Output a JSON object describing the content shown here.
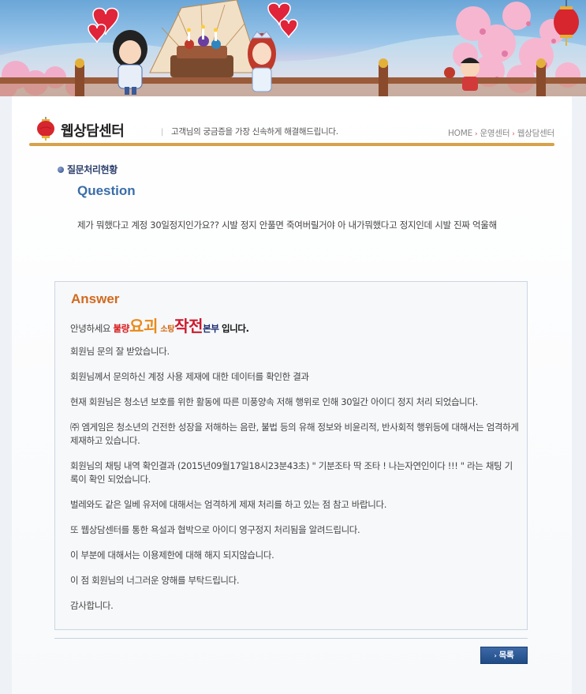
{
  "header": {
    "title": "웹상담센터",
    "subtitle": "고객님의 궁금증을 가장 신속하게 해결해드립니다.",
    "breadcrumb": [
      "HOME",
      "운영센터",
      "웹상담센터"
    ]
  },
  "question": {
    "status_label": "질문처리현황",
    "heading": "Question",
    "body": "제가 뭐했다고 계정 30일정지인가요?? 시발 정지 안풀면 죽여버릴거야 아 내가뭐했다고 정지인데 시발 진짜 억울해"
  },
  "answer": {
    "heading": "Answer",
    "greeting": {
      "prefix": "안녕하세요",
      "w1": "불량",
      "w2": "요괴",
      "w3": "소탕",
      "w4": "작전",
      "w5": "본부",
      "suffix": "입니다."
    },
    "paragraphs": [
      "회원님 문의 잘 받았습니다.",
      "회원님께서 문의하신 계정 사용 제재에 대한 데이터를 확인한 결과",
      "현재 회원님은 청소년 보호를 위한 활동에 따른 미풍양속 저해 행위로 인해 30일간 아이디 정지 처리 되었습니다.",
      "㈜ 엠게임은 청소년의 건전한 성장을 저해하는 음란, 불법 등의 유해 정보와 비윤리적, 반사회적 행위등에 대해서는 엄격하게 제재하고 있습니다.",
      "회원님의 채팅 내역 확인결과 (2015년09월17일18시23분43초) \" 기분조타 딱 조타 ! 나는자연인이다 !!! \" 라는 채팅 기록이 확인 되었습니다.",
      "벌레와도 같은 일베 유저에 대해서는 엄격하게 제재 처리를 하고 있는 점 참고 바랍니다.",
      "또 웹상담센터를 통한 욕설과 협박으로 아이디 영구정지 처리됨을 알려드립니다.",
      "이 부분에 대해서는 이용제한에 대해 해지 되지않습니다.",
      "이 점 회원님의 너그러운 양해를 부탁드립니다.",
      "감사합니다."
    ]
  },
  "buttons": {
    "list": "목록"
  },
  "colors": {
    "accent_line": "#d8a24a",
    "question_heading": "#3a6da8",
    "answer_heading": "#d2691e",
    "button": "#1f4b86"
  },
  "icons": [
    "lantern-icon",
    "bullet-icon",
    "arrow-right-icon"
  ]
}
